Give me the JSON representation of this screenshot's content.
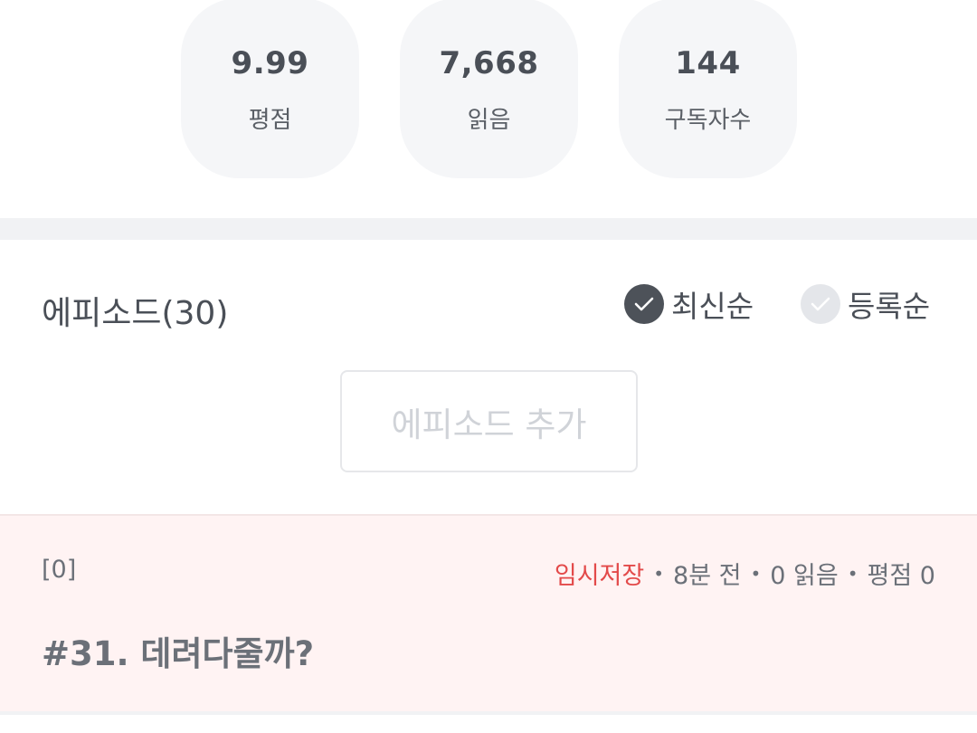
{
  "stats": [
    {
      "value": "9.99",
      "label": "평점"
    },
    {
      "value": "7,668",
      "label": "읽음"
    },
    {
      "value": "144",
      "label": "구독자수"
    }
  ],
  "episodes": {
    "title": "에피소드(30)",
    "sort_latest": "최신순",
    "sort_registered": "등록순",
    "add_button": "에피소드 추가"
  },
  "episode_row": {
    "index": "[0]",
    "status": "임시저장",
    "time": "8분 전",
    "reads": "0 읽음",
    "rating": "평점 0",
    "title": "#31. 데려다줄까?"
  },
  "colors": {
    "draft": "#e34a4a",
    "row_bg": "#fff3f3",
    "check_on": "#4d5259",
    "check_off": "#e4e6ea"
  }
}
